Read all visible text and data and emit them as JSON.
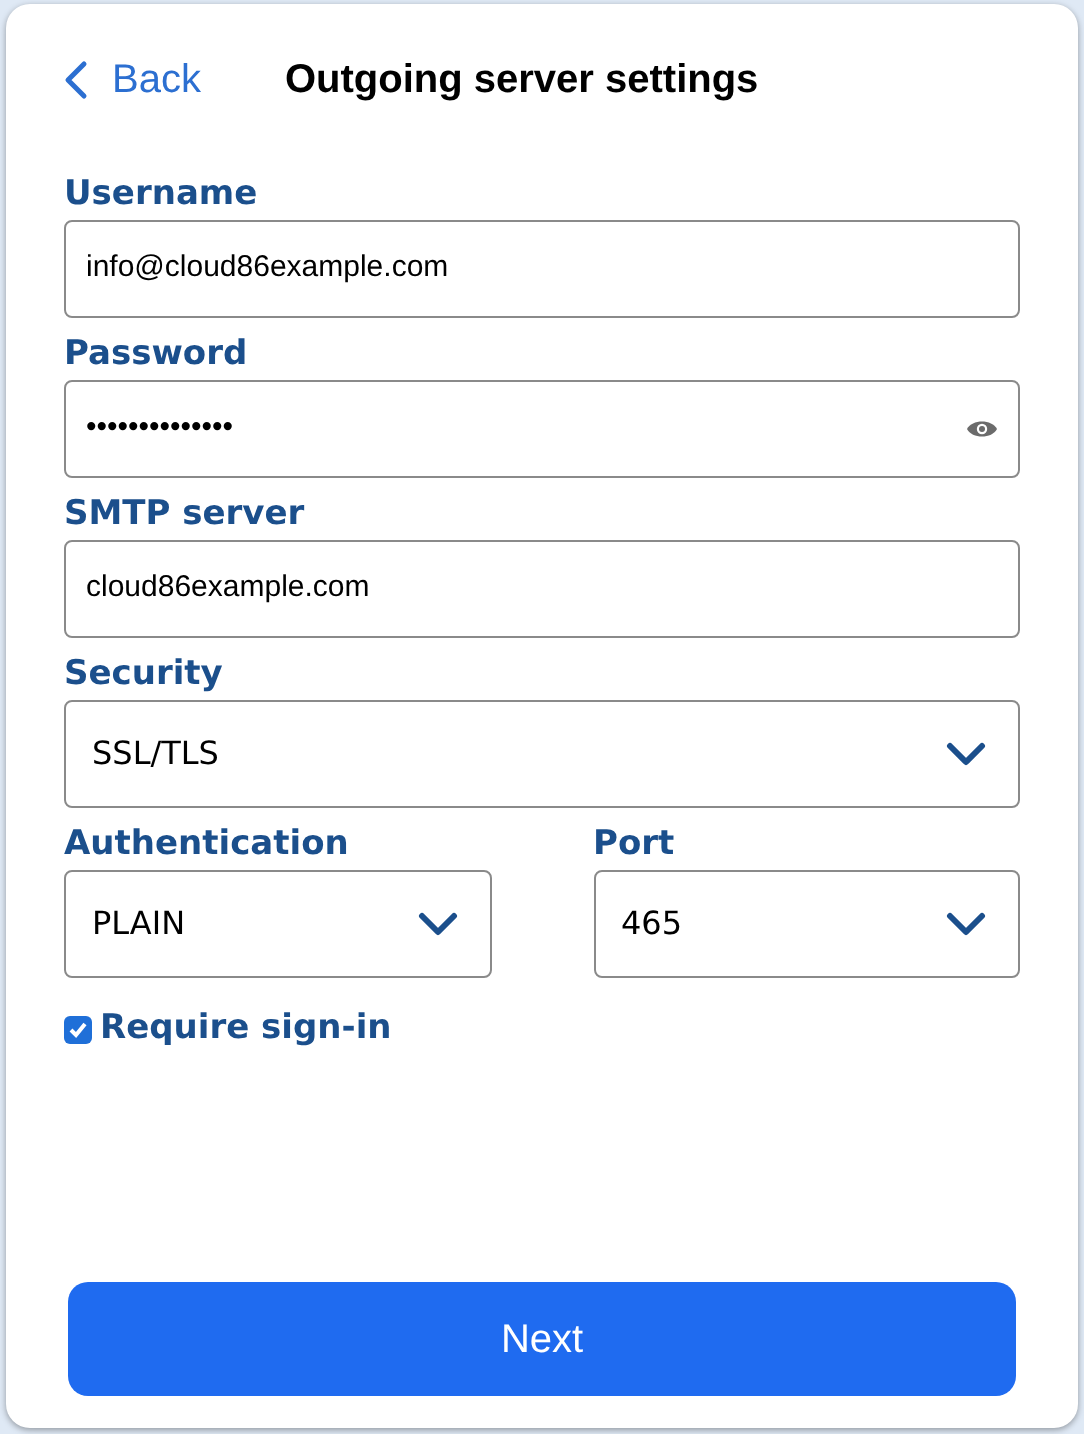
{
  "header": {
    "back": "Back",
    "title": "Outgoing server settings"
  },
  "fields": [
    {
      "kind": "text",
      "label": "Username",
      "value": "info@cloud86example.com"
    },
    {
      "kind": "password",
      "label": "Password",
      "value": "••••••••••••••"
    },
    {
      "kind": "text",
      "label": "SMTP server",
      "value": "cloud86example.com"
    },
    {
      "kind": "select",
      "label": "Security",
      "value": "SSL/TLS"
    },
    {
      "kind": "row",
      "fields": [
        {
          "kind": "select",
          "label": "Authentication",
          "value": "PLAIN"
        },
        {
          "kind": "select",
          "label": "Port",
          "value": "465"
        }
      ]
    }
  ],
  "require_sign_in": {
    "label": "Require sign-in",
    "checked": true
  },
  "next_button": "Next"
}
